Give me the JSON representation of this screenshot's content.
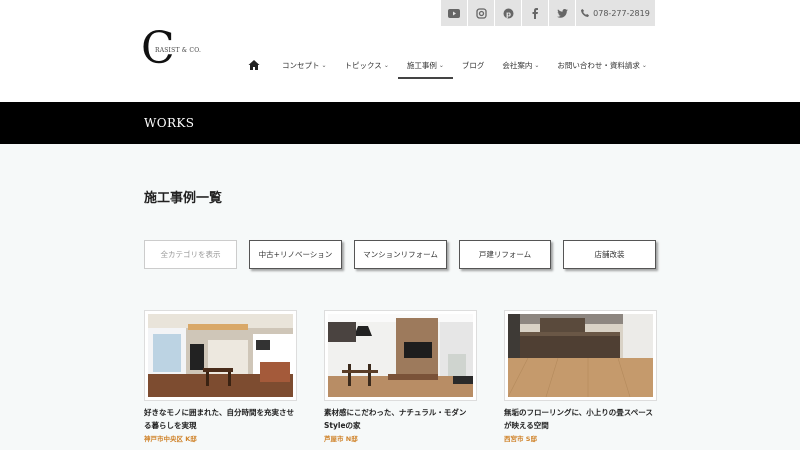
{
  "header": {
    "social_icons": [
      "youtube-icon",
      "instagram-icon",
      "pinterest-icon",
      "facebook-icon",
      "twitter-icon"
    ],
    "phone": "078-277-2819",
    "logo": {
      "letter": "C",
      "text": "RASIST & CO."
    }
  },
  "nav": {
    "items": [
      {
        "label": "コンセプト",
        "dropdown": true
      },
      {
        "label": "トピックス",
        "dropdown": true
      },
      {
        "label": "施工事例",
        "dropdown": true,
        "active": true
      },
      {
        "label": "ブログ",
        "dropdown": false
      },
      {
        "label": "会社案内",
        "dropdown": true
      },
      {
        "label": "お問い合わせ・資料請求",
        "dropdown": true
      }
    ]
  },
  "banner": {
    "title": "WORKS"
  },
  "main": {
    "page_title": "施工事例一覧",
    "filters": [
      "全カテゴリを表示",
      "中古+リノベーション",
      "マンションリフォーム",
      "戸建リフォーム",
      "店舗改装"
    ],
    "cards": [
      {
        "title": "好きなモノに囲まれた、自分時間を充実させる暮らしを実現",
        "location": "神戸市中央区 K邸"
      },
      {
        "title": "素材感にこだわった、ナチュラル・モダンStyleの家",
        "location": "芦屋市 N邸"
      },
      {
        "title": "無垢のフローリングに、小上りの畳スペースが映える空間",
        "location": "西宮市 S邸"
      }
    ]
  },
  "colors": {
    "banner": "#000000",
    "accent": "#d0842c",
    "background": "#f6f9f9"
  }
}
